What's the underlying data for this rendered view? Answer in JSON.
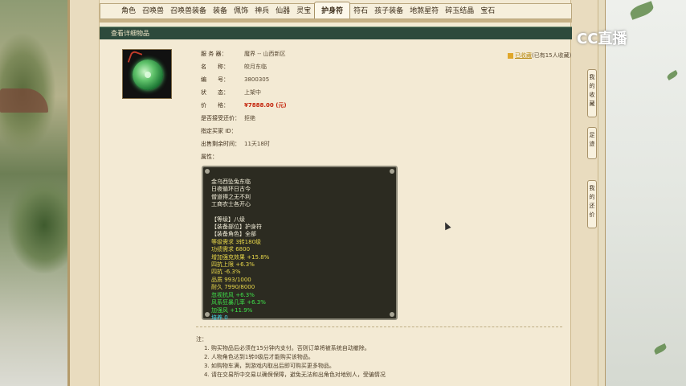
{
  "tabs": [
    "角色",
    "召唤兽",
    "召唤兽装备",
    "装备",
    "佩饰",
    "神兵",
    "仙器",
    "灵宝",
    "护身符",
    "符石",
    "孩子装备",
    "地煞星符",
    "碎玉结晶",
    "宝石"
  ],
  "active_tab": "护身符",
  "section_title": "查看详细物品",
  "collect": {
    "link": "已收藏",
    "count_text": "(已有15人收藏)"
  },
  "info": [
    {
      "k": "服 务 器：",
      "v": "魔界 -- 山西新区"
    },
    {
      "k": "名　　称：",
      "v": "皎月东临"
    },
    {
      "k": "编　　号：",
      "v": "3800305"
    },
    {
      "k": "状　　态：",
      "v": "上架中"
    },
    {
      "k": "价　　格：",
      "v": "¥7888.00 (元)"
    },
    {
      "k": "是否接受还价：",
      "v": "拒绝"
    },
    {
      "k": "指定买家 ID：",
      "v": ""
    },
    {
      "k": "出售剩余时间：",
      "v": "11天18时"
    },
    {
      "k": "属性：",
      "v": ""
    }
  ],
  "attributes": {
    "poem": [
      "金乌西坠兔东临",
      "日夜循环日古今",
      "僧道得之无不利",
      "工商农士各开心"
    ],
    "lines": [
      {
        "text": "【等级】八级",
        "color": "#f5f0dc"
      },
      {
        "text": "【装备部位】护身符",
        "color": "#f5f0dc"
      },
      {
        "text": "【装备角色】全部",
        "color": "#f5f0dc"
      },
      {
        "text": "等级需求 3转180级",
        "color": "#e8d74a"
      },
      {
        "text": "功绩需求 6800",
        "color": "#e8d74a"
      },
      {
        "text": "增加强克效果 +15.8%",
        "color": "#e8d74a"
      },
      {
        "text": "四抗上限 +6.3%",
        "color": "#e8d74a"
      },
      {
        "text": "四抗 -6.3%",
        "color": "#e8d74a"
      },
      {
        "text": "品质 993/1000",
        "color": "#e8d74a"
      },
      {
        "text": "耐久 7990/8000",
        "color": "#e8d74a"
      },
      {
        "text": "忽视抗风 +6.3%",
        "color": "#3fe04a"
      },
      {
        "text": "风系狂暴几率 +6.3%",
        "color": "#3fe04a"
      },
      {
        "text": "加强风 +11.9%",
        "color": "#3fe04a"
      },
      {
        "text": "培养 0",
        "color": "#45d8e8"
      }
    ]
  },
  "notes": {
    "heading": "注：",
    "items": [
      "1. 购买物品后必须在15分钟内支付。否则订单将被系统自动撤除。",
      "2. 人物角色达到1转0级后才能购买该物品。",
      "3. 如购物车满，到游戏内取出后即可购买更多物品。",
      "4. 请在交易所中交易以确保保障，避免无法和出角色对地别人，受骗情况"
    ]
  },
  "side_buttons": [
    "我的收藏",
    "足迹",
    "我的还价"
  ],
  "logo": "CC直播",
  "price_color": "#c3220a"
}
